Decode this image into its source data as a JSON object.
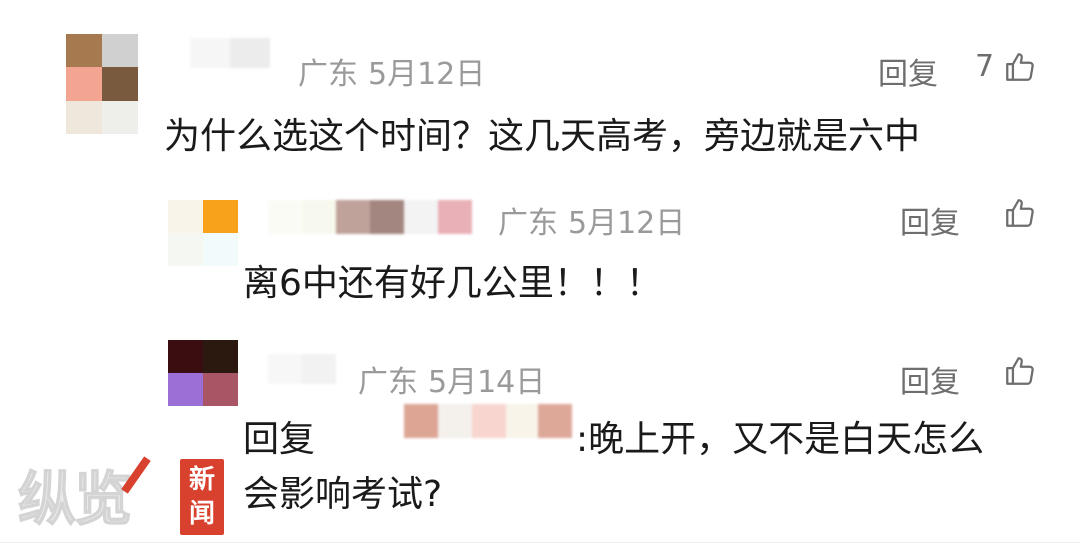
{
  "comments": [
    {
      "location": "广东",
      "date": "5月12日",
      "reply_label": "回复",
      "like_count": "7",
      "text": "为什么选这个时间？这几天高考，旁边就是六中"
    },
    {
      "location": "广东",
      "date": "5月12日",
      "reply_label": "回复",
      "text": "离6中还有好几公里！！！"
    },
    {
      "location": "广东",
      "date": "5月14日",
      "reply_label": "回复",
      "reply_prefix": "回复",
      "text_after_name": ":晚上开，又不是白天怎么",
      "text_line2": "会影响考试?"
    }
  ],
  "watermark": {
    "logo_text": "纵览",
    "badge_line1": "新",
    "badge_line2": "闻"
  },
  "icons": {
    "like": "thumbs-up-icon"
  },
  "colors": {
    "meta_text": "#9a9a9a",
    "body_text": "#1a1a1a",
    "watermark_red": "#d9412f"
  }
}
